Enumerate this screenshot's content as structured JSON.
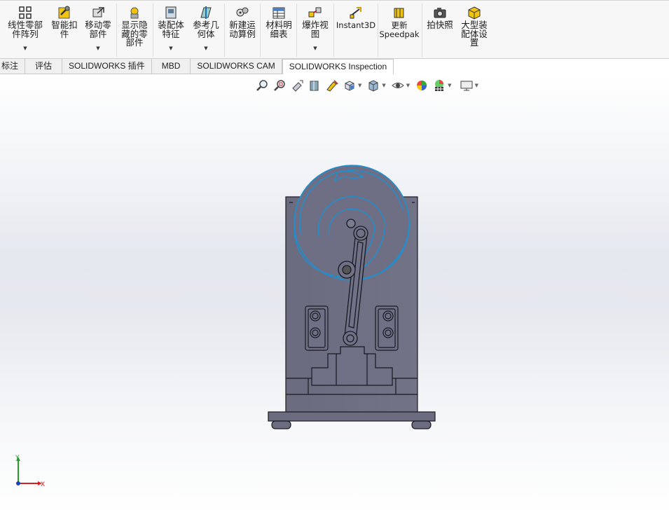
{
  "ribbon": {
    "buttons": [
      {
        "id": "linear-pattern",
        "label": "线性零部\n件阵列",
        "icon": "linear-pattern-icon"
      },
      {
        "id": "smart-fasteners",
        "label": "智能扣\n件",
        "icon": "smart-fasteners-icon"
      },
      {
        "id": "move-component",
        "label": "移动零\n部件",
        "icon": "move-component-icon"
      },
      {
        "id": "show-hidden",
        "label": "显示隐\n藏的零\n部件",
        "icon": "show-hidden-components-icon"
      },
      {
        "id": "assembly-features",
        "label": "装配体\n特征",
        "icon": "assembly-features-icon"
      },
      {
        "id": "reference-geometry",
        "label": "参考几\n何体",
        "icon": "reference-geometry-icon"
      },
      {
        "id": "new-motion-study",
        "label": "新建运\n动算例",
        "icon": "motion-study-icon"
      },
      {
        "id": "bill-of-materials",
        "label": "材料明\n细表",
        "icon": "bom-icon"
      },
      {
        "id": "exploded-view",
        "label": "爆炸视\n图",
        "icon": "exploded-view-icon"
      },
      {
        "id": "instant3d",
        "label": "Instant3D",
        "icon": "instant3d-icon"
      },
      {
        "id": "update-speedpak",
        "label": "更新\nSpeedpak",
        "icon": "speedpak-icon"
      },
      {
        "id": "take-snapshot",
        "label": "拍快照",
        "icon": "camera-icon"
      },
      {
        "id": "large-assembly",
        "label": "大型装\n配体设\n置",
        "icon": "large-assembly-icon"
      }
    ]
  },
  "tabs": [
    "标注",
    "评估",
    "SOLIDWORKS 插件",
    "MBD",
    "SOLIDWORKS CAM",
    "SOLIDWORKS Inspection"
  ],
  "active_tab": "SOLIDWORKS Inspection",
  "heads_up_toolbar": [
    "zoom-to-fit-icon",
    "zoom-to-area-icon",
    "previous-view-icon",
    "section-view-icon",
    "dynamic-annotation-icon",
    "view-orientation-icon",
    "display-style-icon",
    "hide-show-items-icon",
    "edit-appearance-icon",
    "apply-scene-icon",
    "view-settings-icon"
  ],
  "triad": {
    "x_label": "X",
    "y_label": "Y"
  },
  "colors": {
    "part_fill": "#6d6e82",
    "wheel_edge": "#1e8fd0",
    "triad_x": "#d42020",
    "triad_y": "#2a9a2a",
    "triad_origin": "#2040c0"
  }
}
